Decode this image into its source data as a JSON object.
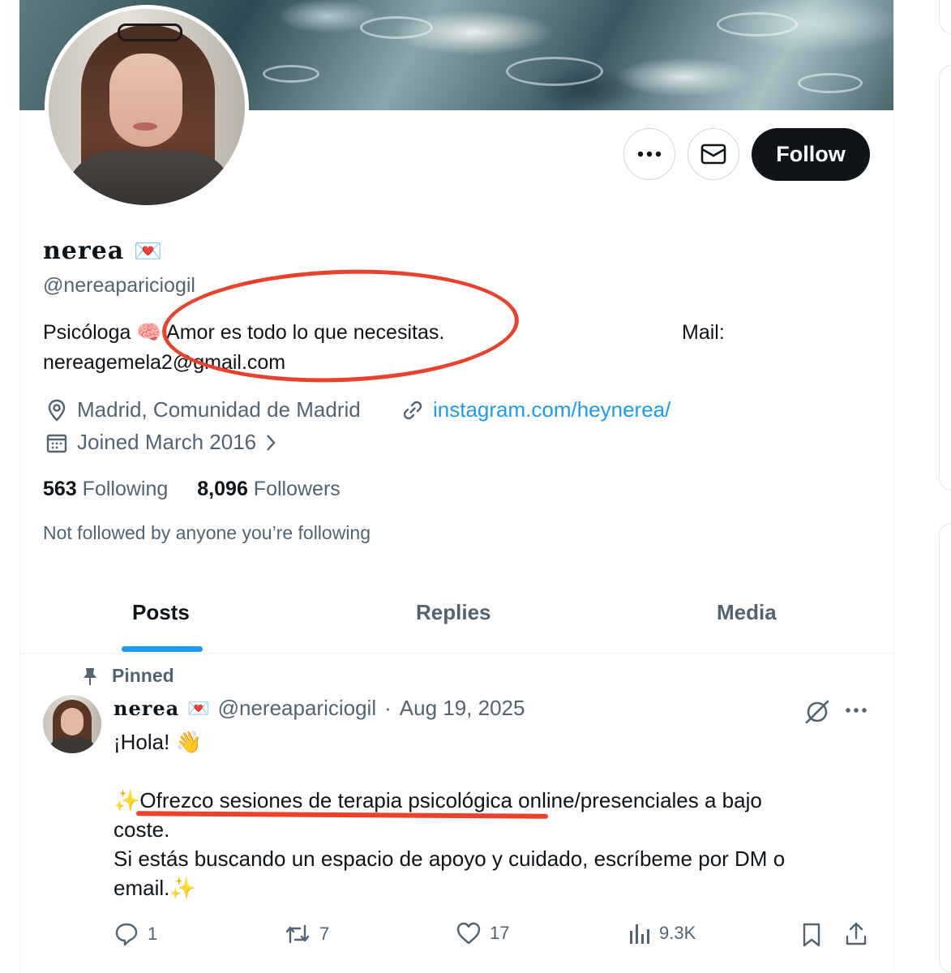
{
  "profile": {
    "display_name": "nerea",
    "name_emoji": "💌",
    "handle": "@nereapariciogil",
    "bio_line1": "Psicóloga 🧠 Amor es todo lo que necesitas.",
    "bio_mail_label": "Mail:",
    "bio_line2": "nereagemela2@gmail.com",
    "location": "Madrid, Comunidad de Madrid",
    "website": "instagram.com/heynerea/",
    "joined": "Joined March 2016",
    "following_count": "563",
    "following_label": "Following",
    "followers_count": "8,096",
    "followers_label": "Followers",
    "not_followed_note": "Not followed by anyone you’re following"
  },
  "header_actions": {
    "more_icon": "ellipsis-icon",
    "message_icon": "mail-icon",
    "follow_label": "Follow"
  },
  "tabs": [
    {
      "label": "Posts",
      "active": true
    },
    {
      "label": "Replies",
      "active": false
    },
    {
      "label": "Media",
      "active": false
    }
  ],
  "pinned_post": {
    "pinned_label": "Pinned",
    "author_name": "nerea",
    "author_emoji": "💌",
    "author_handle": "@nereapariciogil",
    "separator": "·",
    "date": "Aug 19, 2025",
    "text_line1": "¡Hola! 👋",
    "text_line2": "✨Ofrezco sesiones de terapia psicológica online/presenciales a bajo",
    "text_line3": "coste.",
    "text_line4": "Si estás buscando un espacio de apoyo y cuidado, escríbeme por DM o",
    "text_line5": "email.✨",
    "replies": "1",
    "reposts": "7",
    "likes": "17",
    "views": "9.3K"
  },
  "colors": {
    "accent": "#1d9bf0",
    "annotation": "#e8412c",
    "follow_button": "#0f1419",
    "secondary_text": "#536471"
  }
}
